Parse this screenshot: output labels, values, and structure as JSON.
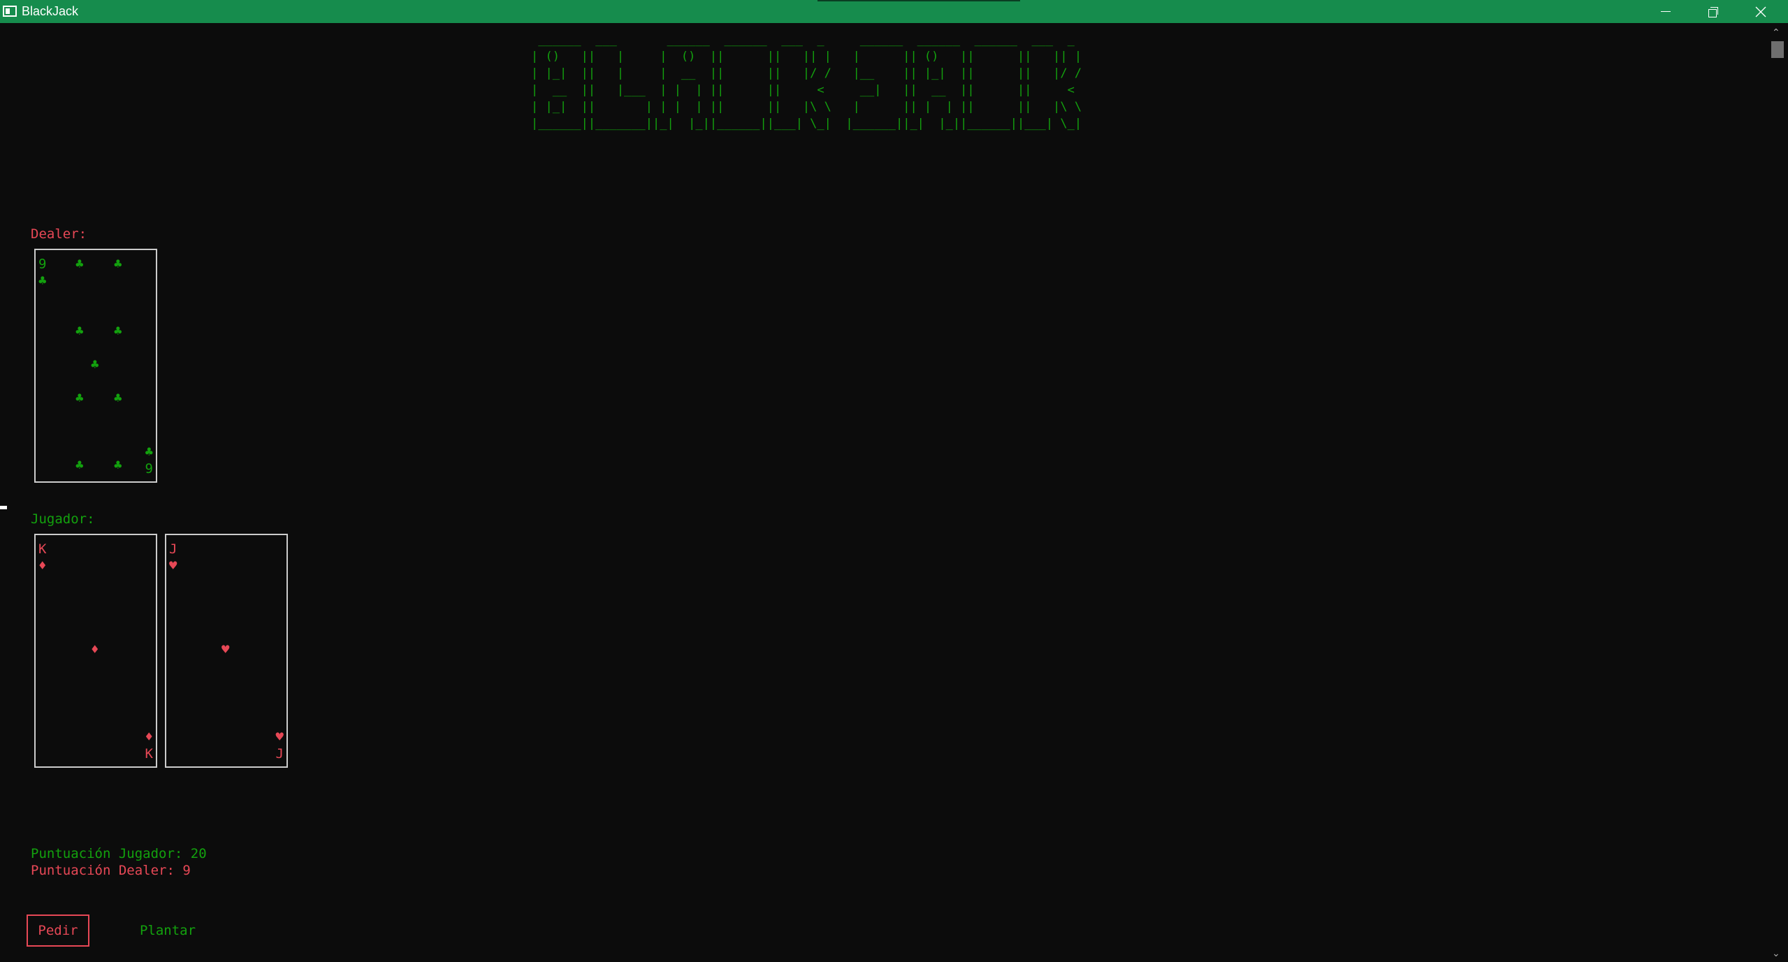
{
  "window": {
    "title": "BlackJack",
    "accent_color": "#168c4d",
    "controls": {
      "minimize_icon": "minimize-icon",
      "maximize_icon": "restore-icon",
      "close_icon": "close-icon"
    }
  },
  "banner": {
    "lines": [
      " ______  ___       ______  ______  ___  _     ______  ______  ______  ___  _ ",
      "| ()   ||   |     |  ()  ||      ||   || |   |      || ()   ||      ||   || |",
      "| |_|  ||   |     |  __  ||      ||   |/ /   |__    || |_|  ||      ||   |/ /",
      "|  __  ||   |___  | |  | ||      ||     <     __|   ||  __  ||      ||     < ",
      "| |_|  ||       | | |  | ||      ||   |\\ \\   |      || |  | ||      ||   |\\ \\",
      "|______||_______||_|  |_||______||___| \\_|  |______||_|  |_||______||___| \\_|"
    ]
  },
  "dealer": {
    "label": "Dealer:",
    "cards": [
      {
        "rank": "9",
        "suit": "♣",
        "color": "#13a10e"
      }
    ]
  },
  "player": {
    "label": "Jugador:",
    "cards": [
      {
        "rank": "K",
        "suit": "♦",
        "color": "#e74856"
      },
      {
        "rank": "J",
        "suit": "♥",
        "color": "#e74856"
      }
    ]
  },
  "scores": {
    "player_label": "Puntuación Jugador: 20",
    "dealer_label": "Puntuación Dealer: 9"
  },
  "actions": {
    "hit_label": "Pedir",
    "stand_label": "Plantar"
  },
  "colors": {
    "green": "#13a10e",
    "red": "#e74856",
    "background": "#0c0c0c"
  }
}
